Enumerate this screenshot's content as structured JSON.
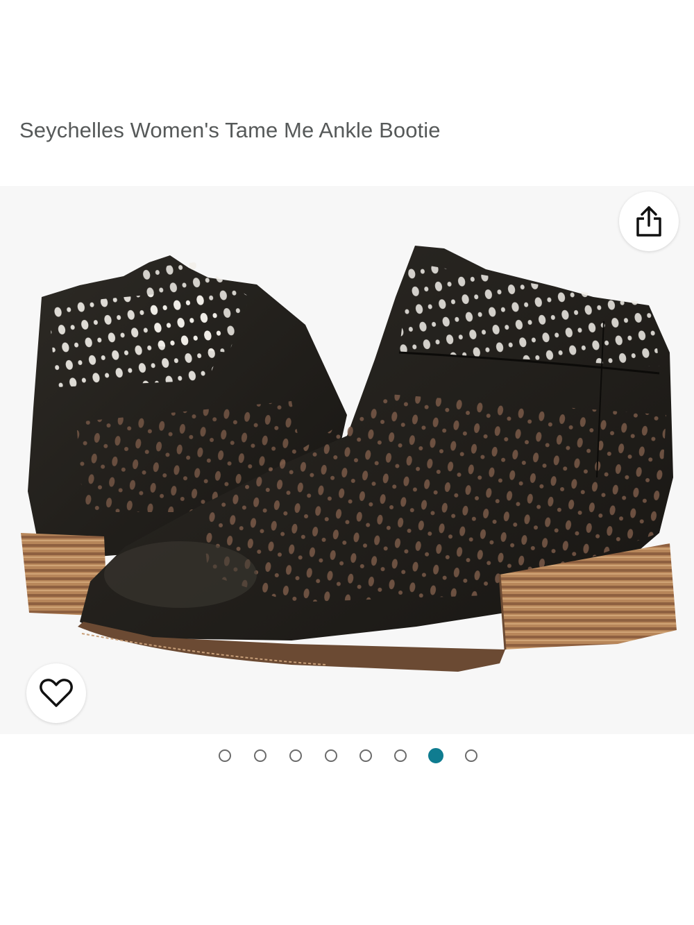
{
  "product": {
    "title": "Seychelles Women's Tame Me Ankle Bootie"
  },
  "carousel": {
    "total": 8,
    "active_index": 6
  },
  "icons": {
    "share": "share-icon",
    "wishlist": "heart-icon"
  },
  "colors": {
    "title_text": "#565959",
    "active_dot": "#0f7c90",
    "inactive_dot": "#6b6b6b",
    "link_green": "#067d62"
  },
  "cutoff_text": ""
}
